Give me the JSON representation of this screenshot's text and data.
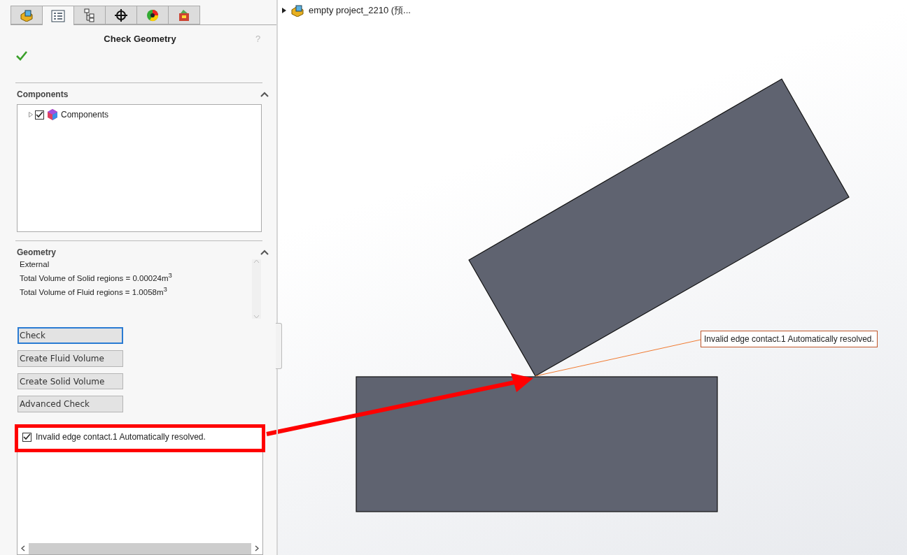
{
  "panel": {
    "tabs": [
      {
        "kind": "part",
        "selected": false
      },
      {
        "kind": "list",
        "selected": true
      },
      {
        "kind": "tree",
        "selected": false
      },
      {
        "kind": "target",
        "selected": false
      },
      {
        "kind": "color",
        "selected": false
      },
      {
        "kind": "scene",
        "selected": false
      }
    ],
    "title": "Check Geometry",
    "help": "?",
    "components": {
      "title": "Components",
      "expanded": true,
      "items": [
        {
          "label": "Components",
          "checked": true,
          "expanded": false
        }
      ]
    },
    "geometry": {
      "title": "Geometry",
      "expanded": true,
      "info_lines": [
        "External",
        "Total Volume of Solid regions = 0.00024m$^{3}$",
        "Total Volume of Fluid regions = 1.0058m$^{3}$"
      ],
      "buttons": [
        {
          "label": "Check",
          "focused": true
        },
        {
          "label": "Create Fluid Volume",
          "focused": false
        },
        {
          "label": "Create Solid Volume",
          "focused": false
        },
        {
          "label": "Advanced Check",
          "focused": false
        }
      ],
      "issues": [
        {
          "label": "Invalid edge contact.1 Automatically resolved.",
          "checked": true,
          "highlighted": true
        }
      ]
    }
  },
  "viewport": {
    "tree_root": {
      "label": "empty project_2210 (預...",
      "expanded": false
    },
    "callout": "Invalid edge contact.1 Automatically resolved."
  }
}
